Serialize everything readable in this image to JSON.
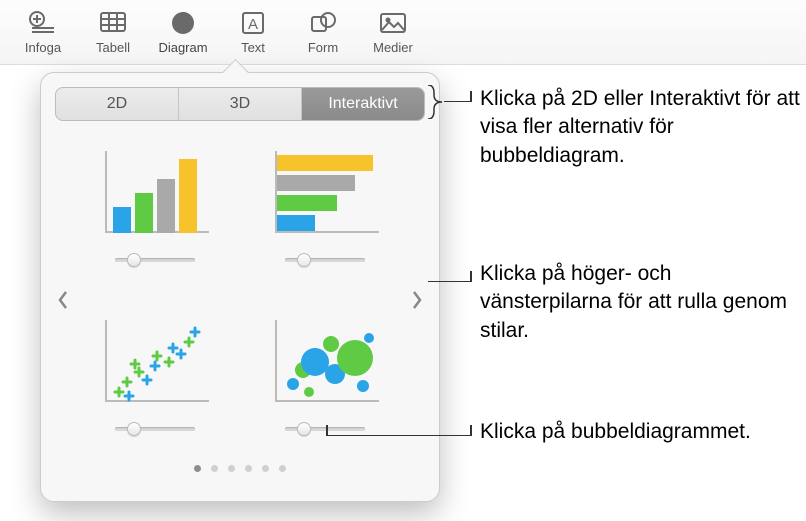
{
  "toolbar": {
    "items": [
      {
        "id": "insert",
        "label": "Infoga"
      },
      {
        "id": "table",
        "label": "Tabell"
      },
      {
        "id": "chart",
        "label": "Diagram"
      },
      {
        "id": "text",
        "label": "Text"
      },
      {
        "id": "shape",
        "label": "Form"
      },
      {
        "id": "media",
        "label": "Medier"
      }
    ]
  },
  "popover": {
    "segments": {
      "two_d": "2D",
      "three_d": "3D",
      "interactive": "Interaktivt"
    },
    "page_count": 6,
    "current_page": 0
  },
  "callouts": {
    "top": "Klicka på 2D eller Interaktivt för att visa fler alternativ för bubbeldiagram.",
    "mid": "Klicka på höger- och vänsterpilarna för att rulla genom stilar.",
    "bot": "Klicka på bubbeldiagrammet."
  },
  "chart_types": {
    "bar_vertical": "interactive-column-chart",
    "bar_horizontal": "interactive-bar-chart",
    "scatter": "interactive-scatter-chart",
    "bubble": "interactive-bubble-chart"
  },
  "colors": {
    "blue": "#2aa4e6",
    "green": "#5fcb45",
    "yellow": "#f6c32b"
  }
}
